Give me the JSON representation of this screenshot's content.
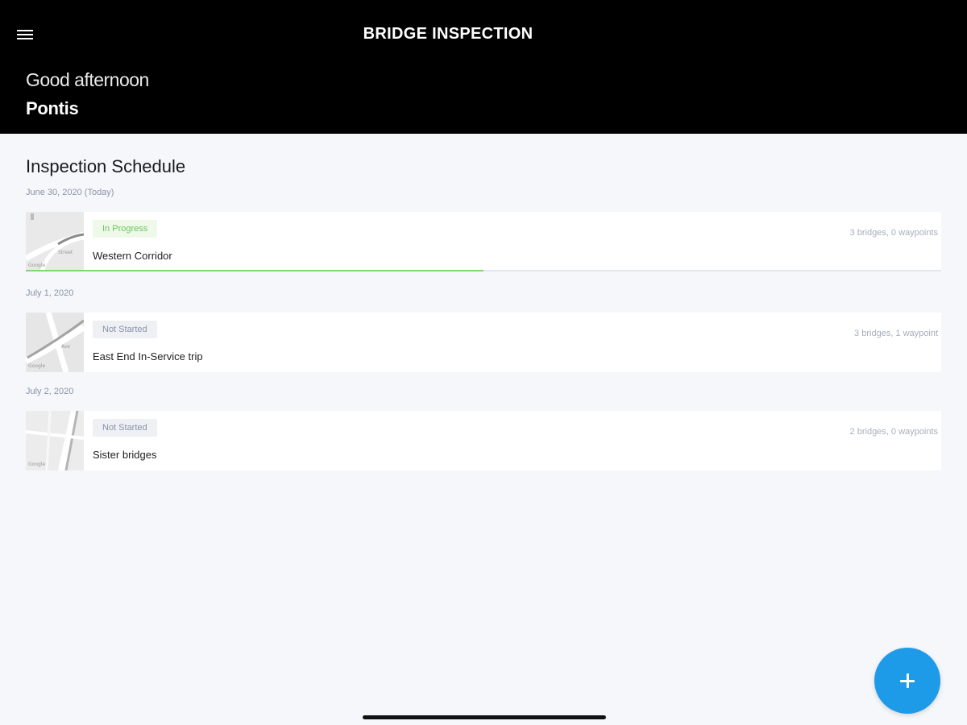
{
  "header": {
    "title": "BRIDGE INSPECTION",
    "greeting": "Good afternoon",
    "user_name": "Pontis",
    "menu_icon": "hamburger-menu-icon"
  },
  "schedule": {
    "title": "Inspection Schedule",
    "groups": [
      {
        "date": "June 30, 2020 (Today)",
        "trips": [
          {
            "status": "In Progress",
            "name": "Western Corridor",
            "count": "3 bridges, 0 waypoints",
            "progress": 0.5
          }
        ]
      },
      {
        "date": "July 1, 2020",
        "trips": [
          {
            "status": "Not Started",
            "name": "East End In-Service trip",
            "count": "3 bridges, 1 waypoint"
          }
        ]
      },
      {
        "date": "July 2, 2020",
        "trips": [
          {
            "status": "Not Started",
            "name": "Sister bridges",
            "count": "2 bridges, 0 waypoints"
          }
        ]
      }
    ]
  },
  "fab": {
    "icon": "plus-icon"
  },
  "colors": {
    "header_bg": "#000000",
    "page_bg": "#f5f7fa",
    "accent": "#1d9be8",
    "in_progress": "#6cc75b",
    "not_started": "#8a93a8"
  }
}
